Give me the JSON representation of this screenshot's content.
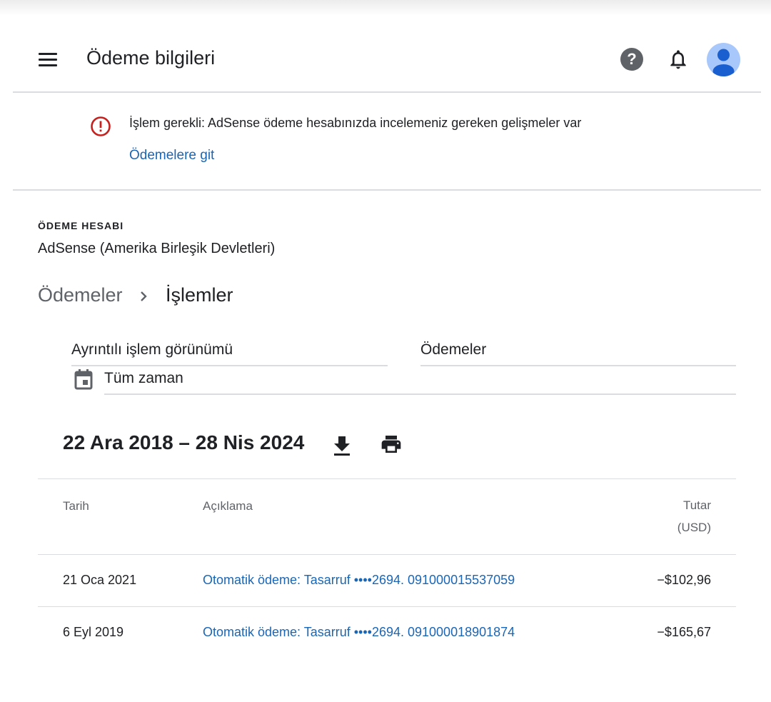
{
  "header": {
    "title": "Ödeme bilgileri",
    "help_icon": "help-circle-icon",
    "bell_icon": "notifications-bell-icon",
    "avatar_color": "#a8c7fa"
  },
  "alert": {
    "icon": "error-circle-icon",
    "icon_color": "#c5221f",
    "message": "İşlem gerekli: AdSense ödeme hesabınızda incelemeniz gereken gelişmeler var",
    "link_label": "Ödemelere git",
    "link_color": "#1a66b5"
  },
  "account": {
    "label": "ÖDEME HESABI",
    "name": "AdSense (Amerika Birleşik Devletleri)"
  },
  "breadcrumb": {
    "parent": "Ödemeler",
    "current": "İşlemler"
  },
  "filters": {
    "view": "Ayrıntılı işlem görünümü",
    "type": "Ödemeler",
    "period": "Tüm zaman"
  },
  "date_range": "22 Ara 2018 – 28 Nis 2024",
  "table": {
    "headers": {
      "date": "Tarih",
      "description": "Açıklama",
      "amount_line1": "Tutar",
      "amount_line2": "(USD)"
    },
    "rows": [
      {
        "date": "21 Oca 2021",
        "description": "Otomatik ödeme: Tasarruf ••••2694. 091000015537059",
        "amount": "−$102,96"
      },
      {
        "date": "6 Eyl 2019",
        "description": "Otomatik ödeme: Tasarruf ••••2694. 091000018901874",
        "amount": "−$165,67"
      }
    ]
  }
}
